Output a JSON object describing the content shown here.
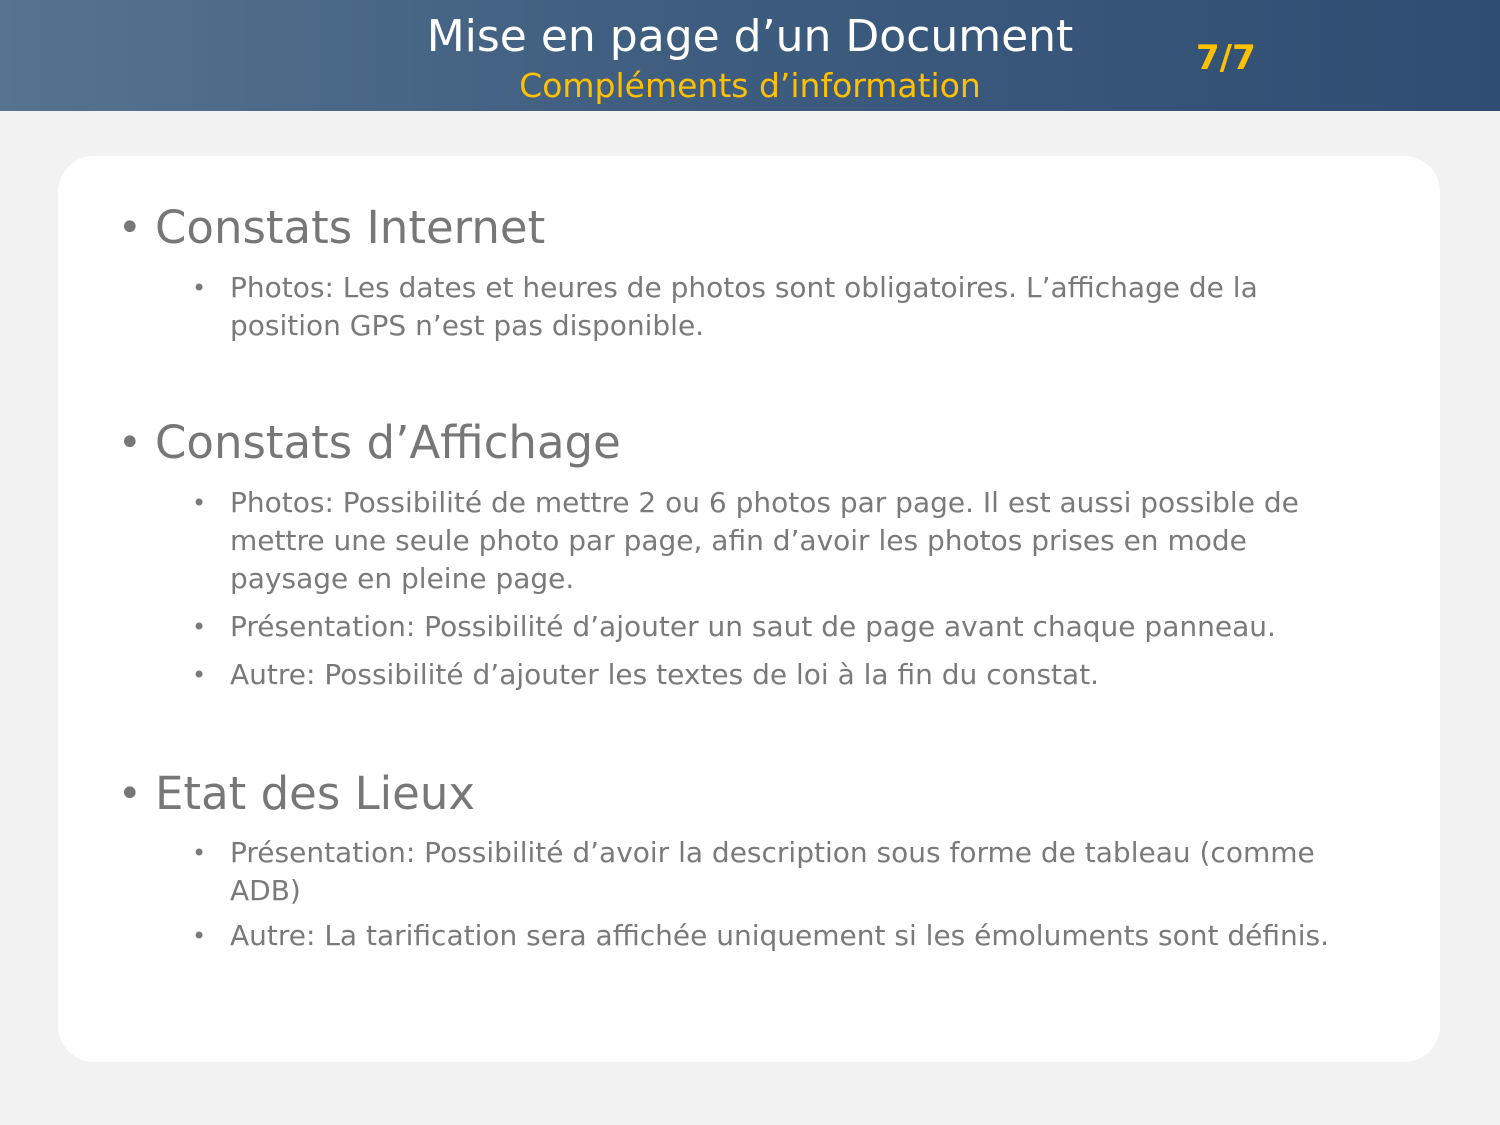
{
  "header": {
    "title": "Mise en page d’un Document",
    "subtitle": "Compléments d’information",
    "page": "7/7",
    "colors": {
      "background": "#3e5d7f",
      "accent": "#ffc000"
    }
  },
  "sections": [
    {
      "heading": "Constats Internet",
      "items": [
        "Photos: Les dates et heures de photos sont obligatoires. L’affichage de la position GPS n’est pas disponible."
      ]
    },
    {
      "heading": "Constats d’Affichage",
      "items": [
        "Photos: Possibilité de mettre 2 ou 6 photos par page. Il est aussi possible de mettre une seule photo par page, afin d’avoir les photos prises en mode paysage en pleine page.",
        "Présentation: Possibilité d’ajouter un saut de page avant chaque panneau.",
        "Autre: Possibilité d’ajouter les textes de loi à la fin du constat."
      ]
    },
    {
      "heading": "Etat des Lieux",
      "items": [
        "Présentation: Possibilité d’avoir la description sous forme de tableau (comme ADB)",
        "Autre: La tarification sera affichée uniquement si les émoluments sont définis."
      ]
    }
  ]
}
